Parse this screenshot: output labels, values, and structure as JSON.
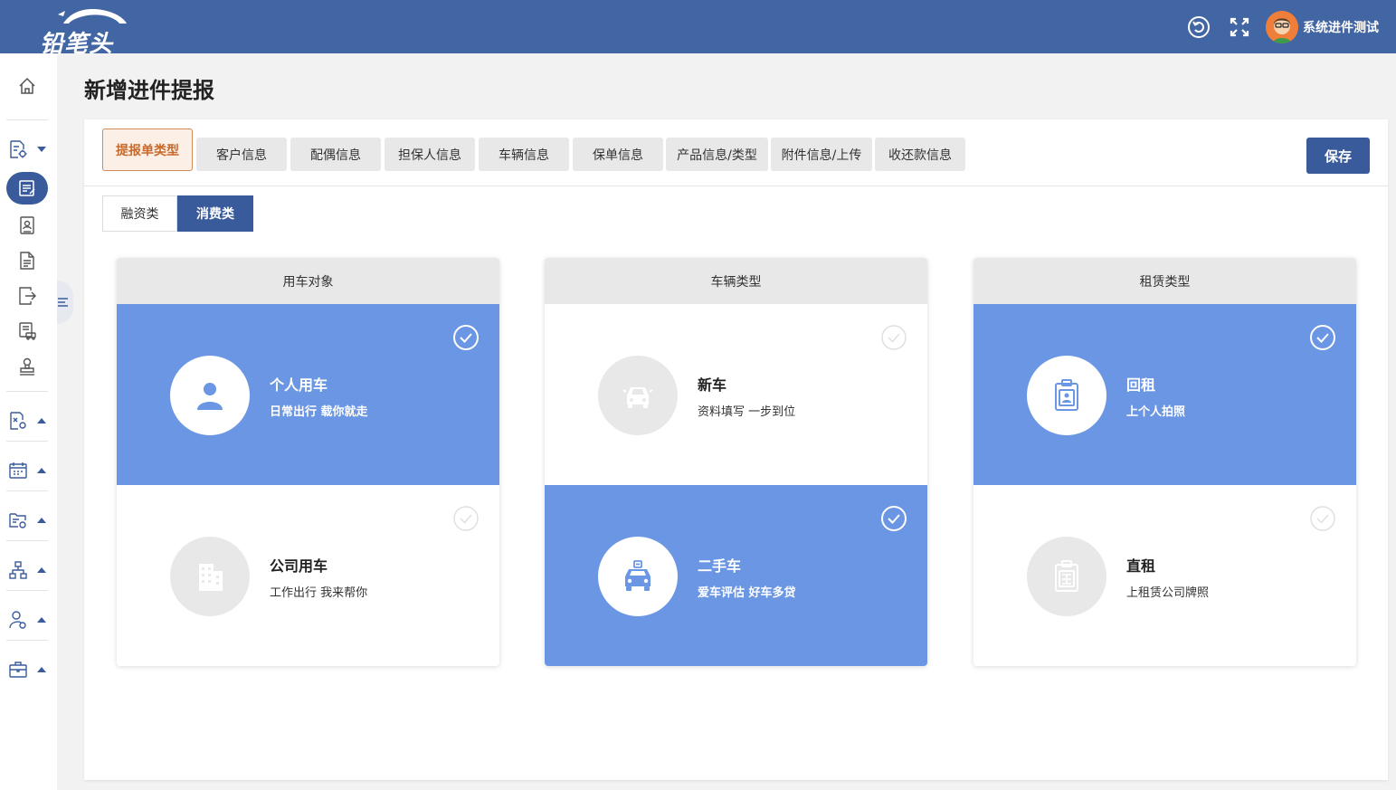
{
  "header": {
    "logo_text": "铅笔头",
    "username": "系统进件测试",
    "icons": [
      "refresh-icon",
      "fullscreen-icon"
    ]
  },
  "sidebar": {
    "items": [
      "home-icon",
      "doc-settings-icon",
      "form-edit-icon",
      "id-card-icon",
      "document-icon",
      "export-icon",
      "car-list-icon",
      "stamp-icon",
      "file-settings-icon",
      "calendar-icon",
      "folder-settings-icon",
      "org-chart-icon",
      "user-settings-icon",
      "briefcase-icon"
    ]
  },
  "page": {
    "title": "新增进件提报"
  },
  "tabs": [
    {
      "label": "提报单类型",
      "active": true
    },
    {
      "label": "客户信息"
    },
    {
      "label": "配偶信息"
    },
    {
      "label": "担保人信息"
    },
    {
      "label": "车辆信息"
    },
    {
      "label": "保单信息"
    },
    {
      "label": "产品信息/类型"
    },
    {
      "label": "附件信息/上传"
    },
    {
      "label": "收还款信息"
    }
  ],
  "save_label": "保存",
  "subtabs": [
    {
      "label": "融资类",
      "active": false
    },
    {
      "label": "消费类",
      "active": true
    }
  ],
  "cards": [
    {
      "header": "用车对象",
      "options": [
        {
          "title": "个人用车",
          "subtitle": "日常出行 载你就走",
          "selected": true,
          "icon": "person-icon"
        },
        {
          "title": "公司用车",
          "subtitle": "工作出行 我来帮你",
          "selected": false,
          "icon": "building-icon"
        }
      ]
    },
    {
      "header": "车辆类型",
      "options": [
        {
          "title": "新车",
          "subtitle": "资料填写 一步到位",
          "selected": false,
          "icon": "new-car-icon"
        },
        {
          "title": "二手车",
          "subtitle": "爱车评估 好车多贷",
          "selected": true,
          "icon": "used-car-icon"
        }
      ]
    },
    {
      "header": "租赁类型",
      "options": [
        {
          "title": "回租",
          "subtitle": "上个人拍照",
          "selected": true,
          "icon": "badge-person-icon"
        },
        {
          "title": "直租",
          "subtitle": "上租赁公司牌照",
          "selected": false,
          "icon": "badge-lease-icon"
        }
      ]
    }
  ],
  "colors": {
    "header_bg": "#4265a3",
    "primary": "#3a5b9b",
    "selected_bg": "#6a96e4",
    "active_tab_border": "#d08a5c",
    "active_tab_text": "#c96a2c"
  }
}
